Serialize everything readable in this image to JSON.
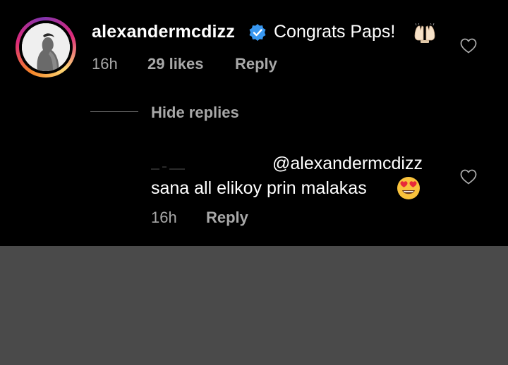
{
  "comment": {
    "username": "alexandermcdizz",
    "text": "Congrats Paps!",
    "time": "16h",
    "likes": "29 likes",
    "reply_label": "Reply"
  },
  "replies_toggle": "Hide replies",
  "reply": {
    "mention": "@alexandermcdizz",
    "text": "sana all elikoy prin malakas",
    "time": "16h",
    "reply_label": "Reply"
  },
  "icons": {
    "verified": "verified-badge-icon",
    "like": "heart-outline-icon",
    "emoji_1": "raised-hands-emoji",
    "emoji_2": "heart-eyes-emoji"
  },
  "colors": {
    "background": "#000000",
    "text": "#ffffff",
    "muted": "#a8a8a8",
    "verified": "#3897f0",
    "lower_area": "#4a4a4a"
  }
}
